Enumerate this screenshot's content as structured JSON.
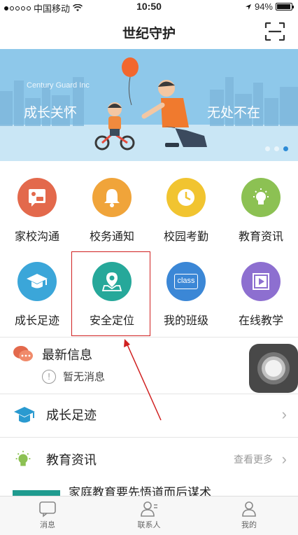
{
  "status_bar": {
    "carrier": "中国移动",
    "time": "10:50",
    "battery": "94%",
    "battery_level": 0.94
  },
  "header": {
    "title": "世纪守护",
    "scan_icon": "scan-icon"
  },
  "banner": {
    "brand": "Century Guard Inc",
    "left_text": "成长关怀",
    "right_text": "无处不在",
    "page_count": 3,
    "active_page": 3
  },
  "grid": [
    {
      "label": "家校沟通",
      "icon": "chat-board-icon",
      "color": "#e3694c"
    },
    {
      "label": "校务通知",
      "icon": "bell-icon",
      "color": "#f0a43a"
    },
    {
      "label": "校园考勤",
      "icon": "clock-icon",
      "color": "#f1c430"
    },
    {
      "label": "教育资讯",
      "icon": "lightbulb-icon",
      "color": "#8cc153"
    },
    {
      "label": "成长足迹",
      "icon": "graduation-cap-icon",
      "color": "#3ba6d9"
    },
    {
      "label": "安全定位",
      "icon": "location-pin-icon",
      "color": "#26a89a"
    },
    {
      "label": "我的班级",
      "icon": "class-icon",
      "color": "#3b87d6",
      "badge": "class"
    },
    {
      "label": "在线教学",
      "icon": "video-play-icon",
      "color": "#8d6fd0"
    }
  ],
  "news": {
    "title": "最新信息",
    "empty_text": "暂无消息"
  },
  "growth_row": {
    "label": "成长足迹"
  },
  "edu_row": {
    "label": "教育资讯",
    "more": "查看更多"
  },
  "article": {
    "title": "家庭教育要先悟道而后谋术"
  },
  "tabs": [
    {
      "label": "消息",
      "icon": "message-icon"
    },
    {
      "label": "联系人",
      "icon": "contacts-icon"
    },
    {
      "label": "我的",
      "icon": "profile-icon"
    }
  ],
  "colors": {
    "banner_bg": "#8ec8ea",
    "highlight": "#d02020",
    "accent": "#2d8bd6"
  }
}
